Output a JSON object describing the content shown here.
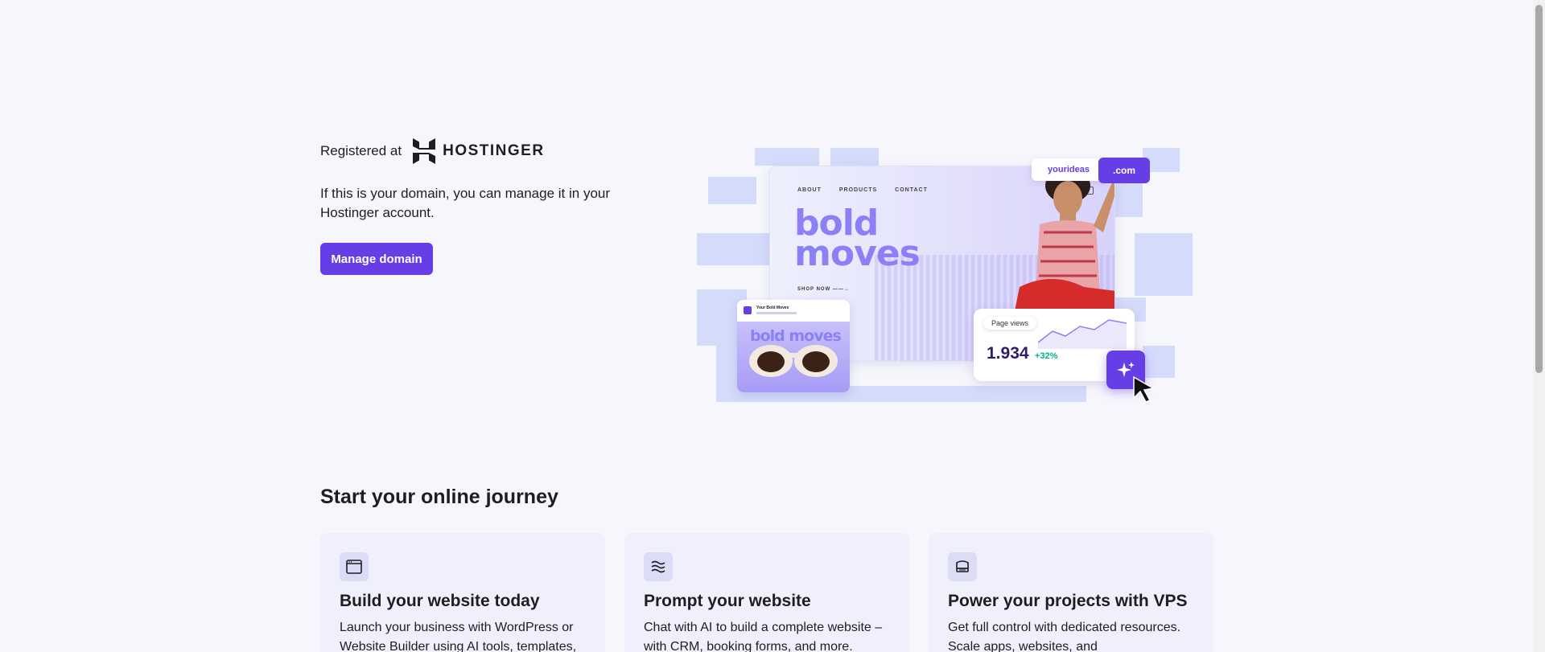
{
  "hero": {
    "registered_label": "Registered at",
    "brand_name": "HOSTINGER",
    "description": "If this is your domain, you can manage it in your Hostinger account.",
    "manage_button": "Manage domain"
  },
  "illustration": {
    "nav": [
      "ABOUT",
      "PRODUCTS",
      "CONTACT"
    ],
    "headline_line1": "bold",
    "headline_line2": "moves",
    "shop_now": "SHOP NOW",
    "domain_name": "yourideas",
    "domain_tld": ".com",
    "social_title": "Your Bold Moves",
    "social_image_text": "bold moves",
    "page_views_label": "Page views",
    "page_views_value": "1.934",
    "page_views_change": "+32%"
  },
  "journey": {
    "title": "Start your online journey",
    "cards": [
      {
        "icon": "browser-window-icon",
        "title": "Build your website today",
        "desc": "Launch your business with WordPress or Website Builder using AI tools, templates,"
      },
      {
        "icon": "ai-waves-icon",
        "title": "Prompt your website",
        "desc": "Chat with AI to build a complete website – with CRM, booking forms, and more."
      },
      {
        "icon": "server-icon",
        "title": "Power your projects with VPS",
        "desc": "Get full control with dedicated resources. Scale apps, websites, and"
      }
    ]
  },
  "colors": {
    "accent": "#673de6",
    "background": "#f6f7fc",
    "card_background": "#eff0fb",
    "growth": "#00b090"
  }
}
